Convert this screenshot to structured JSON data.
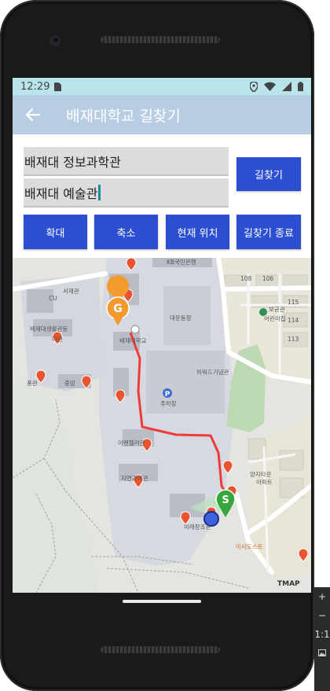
{
  "status": {
    "time": "12:29"
  },
  "appbar": {
    "title": "배재대학교 길찾기"
  },
  "form": {
    "start_value": "배재대 정보과학관",
    "end_value": "배재대 예술관",
    "find_label": "길찾기",
    "zoom_in_label": "확대",
    "zoom_out_label": "축소",
    "current_location_label": "현재 위치",
    "end_route_label": "길찾기 종료"
  },
  "map": {
    "labels": {
      "kb": "KB국민은행",
      "seojae": "서재관",
      "cu": "CU",
      "baejae_hall": "배재대생활관동",
      "dong": "다관",
      "baejae_univ": "배재대학교",
      "stadium": "대운동장",
      "g": "G",
      "s": "S",
      "parking": "주차장",
      "parking_icon": "P",
      "pungsan": "풍관",
      "jungang": "중앙",
      "arts": "아펜젤러관",
      "library": "하워드기념관",
      "pulo": "치민관",
      "nature": "자연과학관",
      "mirae": "미래창조관",
      "mart": "이사도스트",
      "yangji": "양지타운",
      "apt": "아파트",
      "kinder": "보균관",
      "kinder2": "어린이집",
      "b108": "108",
      "b106": "106",
      "b115": "115",
      "b114": "114",
      "b113": "113",
      "tmap": "TMAP"
    }
  },
  "emulator": {
    "plus": "+",
    "minus": "−",
    "ratio": "1:1"
  }
}
